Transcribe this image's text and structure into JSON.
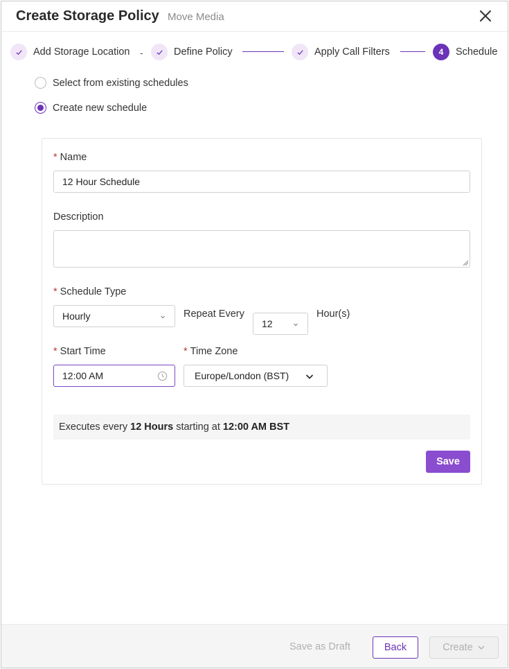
{
  "header": {
    "title": "Create Storage Policy",
    "subtitle": "Move Media"
  },
  "stepper": {
    "steps": [
      {
        "label": "Add Storage Location",
        "state": "done"
      },
      {
        "label": "Define Policy",
        "state": "done"
      },
      {
        "label": "Apply Call Filters",
        "state": "done"
      },
      {
        "label": "Schedule",
        "state": "active",
        "number": "4"
      }
    ],
    "separator": "-"
  },
  "schedule_source": {
    "options": [
      {
        "label": "Select from existing schedules",
        "checked": false
      },
      {
        "label": "Create new schedule",
        "checked": true
      }
    ]
  },
  "form": {
    "name_label": "Name",
    "name_value": "12 Hour Schedule",
    "description_label": "Description",
    "description_value": "",
    "schedule_type_label": "Schedule Type",
    "schedule_type_value": "Hourly",
    "repeat_every_label": "Repeat Every",
    "repeat_every_value": "12",
    "repeat_unit": "Hour(s)",
    "start_time_label": "Start Time",
    "start_time_value": "12:00 AM",
    "time_zone_label": "Time Zone",
    "time_zone_value": "Europe/London (BST)",
    "required_marker": "*"
  },
  "summary": {
    "prefix": "Executes every",
    "interval": "12 Hours",
    "middle": "starting at",
    "start": "12:00 AM BST"
  },
  "card_save_label": "Save",
  "footer": {
    "draft_label": "Save as Draft",
    "back_label": "Back",
    "create_label": "Create"
  },
  "colors": {
    "accent": "#6b33b7",
    "button": "#8a4dcf",
    "required": "#c0392b"
  }
}
